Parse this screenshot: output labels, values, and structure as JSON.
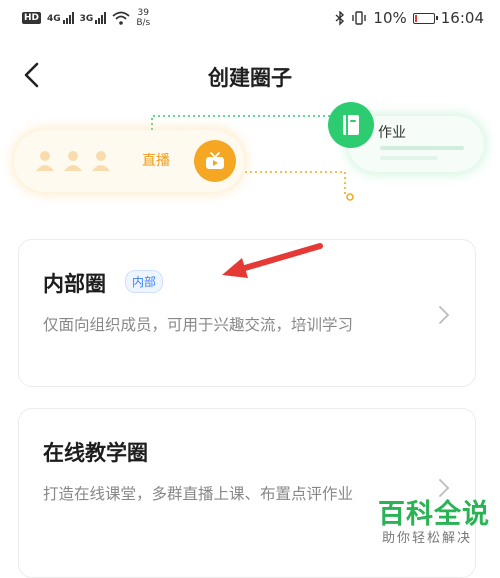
{
  "status_bar": {
    "network_badge": "HD",
    "signal1_label": "4G",
    "signal2_label": "3G",
    "speed_value": "39",
    "speed_unit": "B/s",
    "battery_percent": "10%",
    "battery_level": 0.1,
    "time": "16:04"
  },
  "header": {
    "title": "创建圈子"
  },
  "illustration": {
    "live_label": "直播",
    "homework_label": "作业"
  },
  "cards": [
    {
      "title": "内部圈",
      "badge": "内部",
      "description": "仅面向组织成员，可用于兴趣交流，培训学习"
    },
    {
      "title": "在线教学圈",
      "description": "打造在线课堂，多群直播上课、布置点评作业"
    }
  ],
  "watermark": {
    "title": "百科全说",
    "subtitle": "助你轻松解决"
  },
  "colors": {
    "live_orange": "#f5a623",
    "homework_green": "#2ecc71",
    "annotation_red": "#e53935",
    "badge_blue": "#3b82f6",
    "watermark_green": "#29b355"
  }
}
